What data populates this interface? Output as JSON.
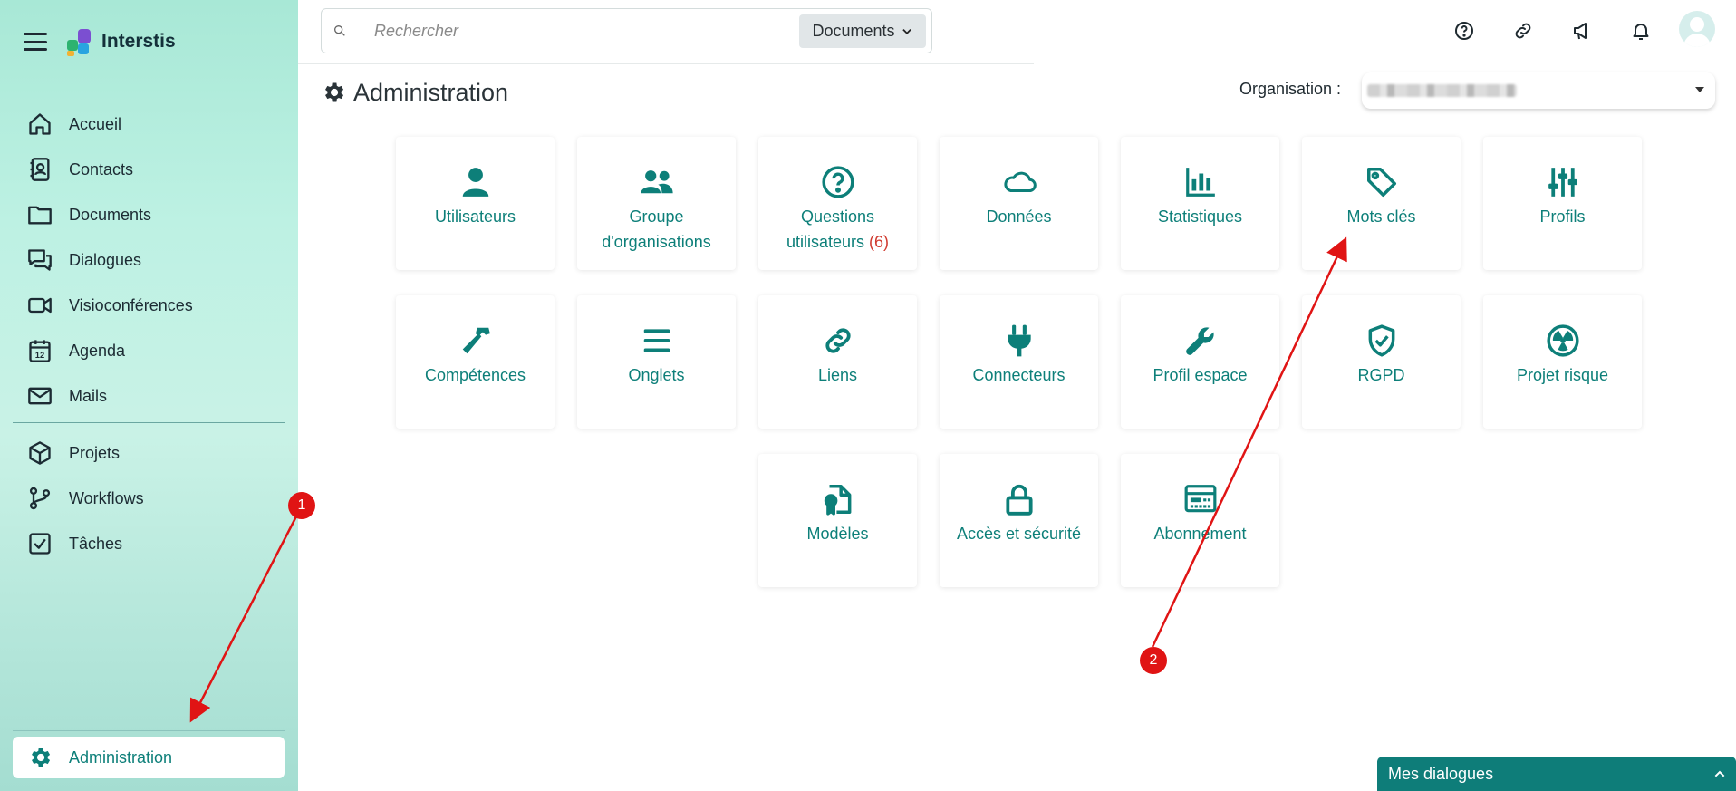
{
  "app": {
    "name": "Interstis"
  },
  "sidebar": {
    "items": [
      {
        "label": "Accueil",
        "icon": "home-icon"
      },
      {
        "label": "Contacts",
        "icon": "contacts-icon"
      },
      {
        "label": "Documents",
        "icon": "folder-icon"
      },
      {
        "label": "Dialogues",
        "icon": "dialogues-icon"
      },
      {
        "label": "Visioconférences",
        "icon": "video-icon"
      },
      {
        "label": "Agenda",
        "icon": "calendar-icon"
      },
      {
        "label": "Mails",
        "icon": "mail-icon"
      },
      {
        "label": "Projets",
        "icon": "cube-icon"
      },
      {
        "label": "Workflows",
        "icon": "workflow-icon"
      },
      {
        "label": "Tâches",
        "icon": "checkbox-icon"
      }
    ],
    "admin": {
      "label": "Administration",
      "icon": "gear-icon"
    }
  },
  "search": {
    "placeholder": "Rechercher",
    "scope": "Documents"
  },
  "header": {
    "icons": [
      "help-icon",
      "link-icon",
      "announce-icon",
      "bell-icon",
      "avatar"
    ]
  },
  "page": {
    "title": "Administration",
    "org_label": "Organisation :"
  },
  "cards": [
    {
      "label": "Utilisateurs",
      "icon": "user-icon"
    },
    {
      "label": "Groupe d'organisations",
      "icon": "users-icon"
    },
    {
      "label": "Questions utilisateurs",
      "count": "(6)",
      "icon": "question-icon"
    },
    {
      "label": "Données",
      "icon": "cloud-icon"
    },
    {
      "label": "Statistiques",
      "icon": "chart-icon"
    },
    {
      "label": "Mots clés",
      "icon": "tag-icon"
    },
    {
      "label": "Profils",
      "icon": "sliders-icon"
    },
    {
      "label": "Compétences",
      "icon": "hammer-icon"
    },
    {
      "label": "Onglets",
      "icon": "list-icon"
    },
    {
      "label": "Liens",
      "icon": "link-icon"
    },
    {
      "label": "Connecteurs",
      "icon": "plug-icon"
    },
    {
      "label": "Profil espace",
      "icon": "wrench-icon"
    },
    {
      "label": "RGPD",
      "icon": "shield-check-icon"
    },
    {
      "label": "Projet risque",
      "icon": "radiation-icon"
    },
    {
      "label": "Modèles",
      "icon": "template-icon"
    },
    {
      "label": "Accès et sécurité",
      "icon": "lock-icon"
    },
    {
      "label": "Abonnement",
      "icon": "id-card-icon"
    }
  ],
  "annotations": [
    {
      "number": "1",
      "target": "Administration"
    },
    {
      "number": "2",
      "target": "Mots clés"
    }
  ],
  "dialogues_panel": {
    "label": "Mes dialogues"
  },
  "colors": {
    "accent": "#0d7f79",
    "badge": "#e01414",
    "panel": "#0e7d79"
  }
}
